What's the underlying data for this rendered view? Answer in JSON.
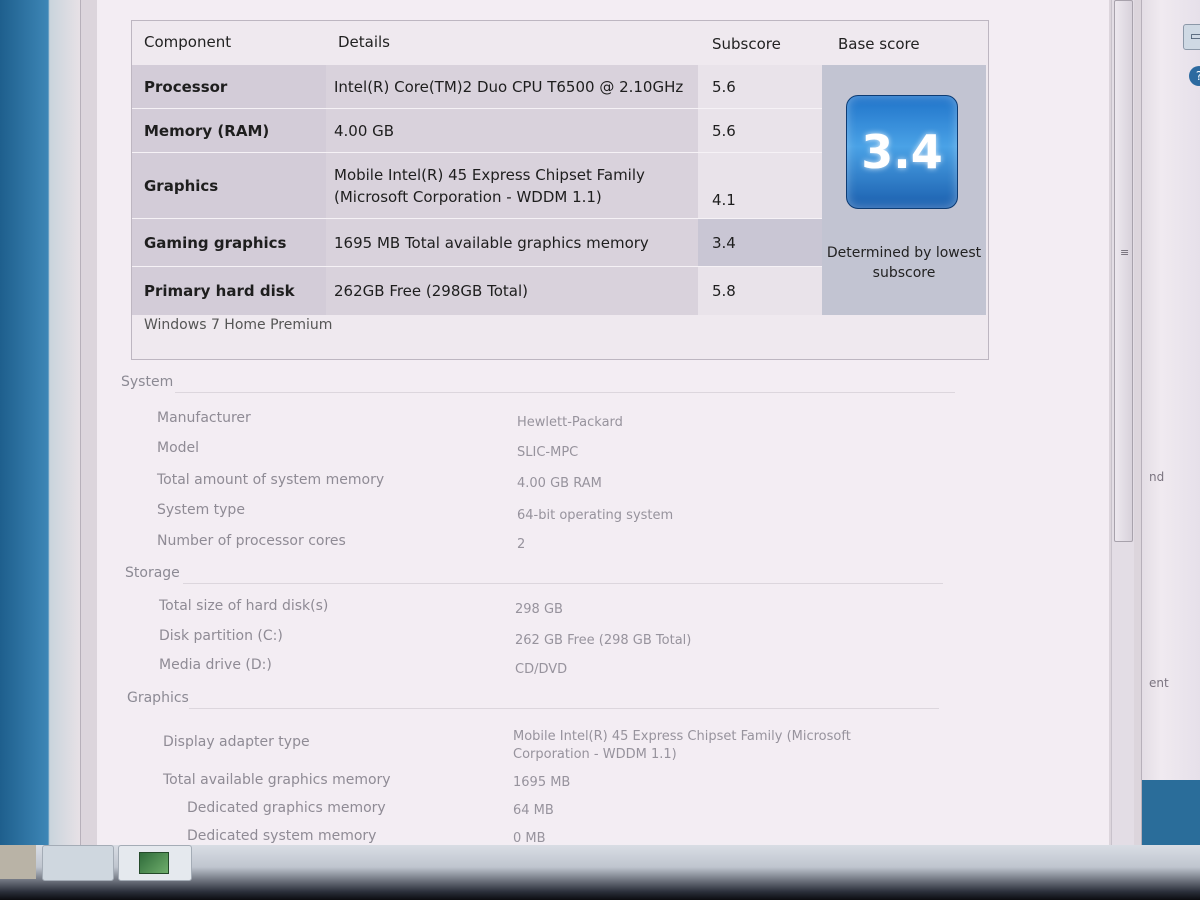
{
  "score_table": {
    "headers": {
      "component": "Component",
      "details": "Details",
      "subscore": "Subscore",
      "base_score": "Base score"
    },
    "rows": [
      {
        "component": "Processor",
        "details": "Intel(R) Core(TM)2 Duo CPU T6500 @ 2.10GHz",
        "subscore": "5.6"
      },
      {
        "component": "Memory (RAM)",
        "details": "4.00 GB",
        "subscore": "5.6"
      },
      {
        "component": "Graphics",
        "details": "Mobile Intel(R) 45 Express Chipset Family (Microsoft Corporation - WDDM 1.1)",
        "subscore": "4.1"
      },
      {
        "component": "Gaming graphics",
        "details": "1695 MB Total available graphics memory",
        "subscore": "3.4"
      },
      {
        "component": "Primary hard disk",
        "details": "262GB Free (298GB Total)",
        "subscore": "5.8"
      }
    ],
    "base_score_value": "3.4",
    "base_score_caption": "Determined by lowest subscore",
    "edition": "Windows 7 Home Premium"
  },
  "system": {
    "title": "System",
    "items": [
      {
        "label": "Manufacturer",
        "value": "Hewlett-Packard"
      },
      {
        "label": "Model",
        "value": "SLIC-MPC"
      },
      {
        "label": "Total amount of system memory",
        "value": "4.00 GB RAM"
      },
      {
        "label": "System type",
        "value": "64-bit operating system"
      },
      {
        "label": "Number of processor cores",
        "value": "2"
      }
    ]
  },
  "storage": {
    "title": "Storage",
    "items": [
      {
        "label": "Total size of hard disk(s)",
        "value": "298 GB"
      },
      {
        "label": "Disk partition (C:)",
        "value": "262 GB Free (298 GB Total)"
      },
      {
        "label": "Media drive (D:)",
        "value": "CD/DVD"
      }
    ]
  },
  "graphics": {
    "title": "Graphics",
    "items": [
      {
        "label": "Display adapter type",
        "value": "Mobile Intel(R) 45 Express Chipset Family (Microsoft Corporation - WDDM 1.1)"
      },
      {
        "label": "Total available graphics memory",
        "value": "1695 MB"
      },
      {
        "label": "Dedicated graphics memory",
        "value": "64 MB"
      },
      {
        "label": "Dedicated system memory",
        "value": "0 MB"
      }
    ]
  },
  "background_window": {
    "partial_text_1": "nd",
    "partial_text_2": "ent"
  },
  "colors": {
    "badge": "#1f73c9",
    "row_shade": "#d3ccd8",
    "base_panel": "#c2c4d2"
  }
}
